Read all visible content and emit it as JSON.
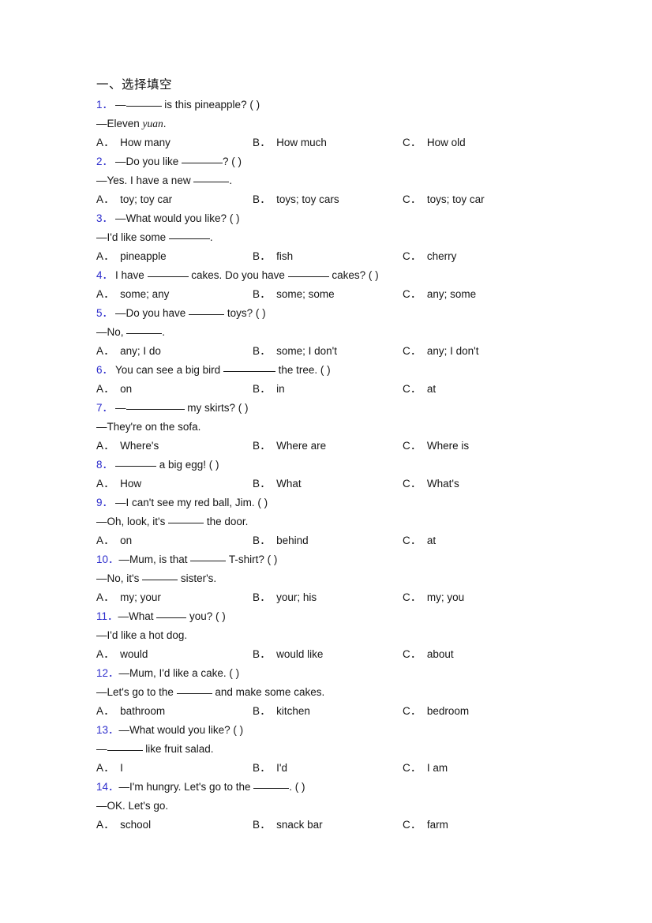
{
  "document": {
    "section_title": "一、选择填空",
    "option_labels": [
      "A．",
      "B．",
      "C．"
    ]
  },
  "questions": [
    {
      "num": "1．",
      "stem_pre": "—",
      "blank": "b6",
      "stem_post": " is this pineapple? (  )",
      "dialog": "—Eleven ",
      "dialog_italic": "yuan",
      "dialog_tail": ".",
      "options": [
        "How many",
        "How much",
        "How old"
      ]
    },
    {
      "num": "2．",
      "stem_pre": "—Do you like ",
      "blank": "b7",
      "stem_post": "? (  )",
      "dialog": "—Yes. I have a new ",
      "dialog_blank": "b6",
      "dialog_tail": ".",
      "options": [
        "toy; toy car",
        "toys; toy cars",
        "toys; toy car"
      ]
    },
    {
      "num": "3．",
      "stem_pre": "—What would you like? (  )",
      "dialog": "—I'd like some ",
      "dialog_blank": "b7",
      "dialog_tail": ".",
      "options": [
        "pineapple",
        "fish",
        "cherry"
      ]
    },
    {
      "num": "4．",
      "stem_pre": "I have ",
      "blank": "b7",
      "stem_mid": " cakes. Do you have ",
      "blank2": "b7",
      "stem_post": " cakes? (  )",
      "options": [
        "some; any",
        "some; some",
        "any; some"
      ]
    },
    {
      "num": "5．",
      "stem_pre": "—Do you have ",
      "blank": "b6",
      "stem_post": " toys? (  )",
      "dialog": "—No, ",
      "dialog_blank": "b6",
      "dialog_tail": ".",
      "options": [
        "any; I do",
        "some; I don't",
        "any; I don't"
      ]
    },
    {
      "num": "6．",
      "stem_pre": "You can see a big bird ",
      "blank": "b9",
      "stem_post": " the tree. (  )",
      "options": [
        "on",
        "in",
        "at"
      ]
    },
    {
      "num": "7．",
      "stem_pre": "—",
      "blank": "b10",
      "stem_post": " my skirts? (  )",
      "dialog": "—They're on the sofa.",
      "options": [
        "Where's",
        "Where are",
        "Where is"
      ]
    },
    {
      "num": "8．",
      "stem_pre": "",
      "blank": "b7",
      "stem_post": " a big egg! (  )",
      "options": [
        "How",
        "What",
        "What's"
      ]
    },
    {
      "num": "9．",
      "stem_pre": "—I can't see my red ball, Jim. (  )",
      "dialog": "—Oh, look, it's ",
      "dialog_blank": "b6",
      "dialog_tail": " the door.",
      "options": [
        "on",
        "behind",
        "at"
      ]
    },
    {
      "num": "10．",
      "stem_pre": "—Mum, is that ",
      "blank": "b6",
      "stem_post": " T-shirt? (  )",
      "dialog": "—No, it's ",
      "dialog_blank": "b6",
      "dialog_tail": " sister's.",
      "options": [
        "my; your",
        "your; his",
        "my; you"
      ]
    },
    {
      "num": "11．",
      "stem_pre": "—What ",
      "blank": "b5",
      "stem_post": " you? (  )",
      "dialog": "—I'd like a hot dog.",
      "options": [
        "would",
        "would like",
        "about"
      ]
    },
    {
      "num": "12．",
      "stem_pre": "—Mum, I'd like a cake. (  )",
      "dialog": "—Let's go to the ",
      "dialog_blank": "b6",
      "dialog_tail": " and make some cakes.",
      "options": [
        "bathroom",
        "kitchen",
        "bedroom"
      ]
    },
    {
      "num": "13．",
      "stem_pre": "—What would you like? (  )",
      "dialog": "—",
      "dialog_blank": "b6",
      "dialog_tail": " like fruit salad.",
      "options": [
        "I",
        "I'd",
        "I am"
      ]
    },
    {
      "num": "14．",
      "stem_pre": "—I'm hungry. Let's go to the ",
      "blank": "b6",
      "stem_post": ". (  )",
      "dialog": "—OK. Let's go.",
      "options": [
        "school",
        "snack bar",
        "farm"
      ]
    }
  ]
}
